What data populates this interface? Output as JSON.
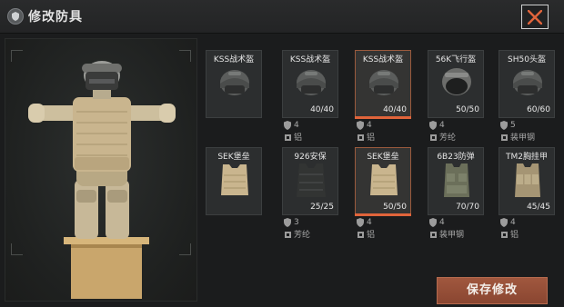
{
  "title": "修改防具",
  "save_label": "保存修改",
  "accent": "#e0643b",
  "items": [
    {
      "name": "KSS战术盔",
      "durability": "",
      "armor_class": "",
      "material": "",
      "selected": false,
      "kind": "helmet"
    },
    {
      "name": "KSS战术盔",
      "durability": "40/40",
      "armor_class": "4",
      "material": "铝",
      "selected": false,
      "kind": "helmet"
    },
    {
      "name": "KSS战术盔",
      "durability": "40/40",
      "armor_class": "4",
      "material": "铝",
      "selected": true,
      "kind": "helmet"
    },
    {
      "name": "56K飞行盔",
      "durability": "50/50",
      "armor_class": "4",
      "material": "芳纶",
      "selected": false,
      "kind": "helmet-visor"
    },
    {
      "name": "SH50头盔",
      "durability": "60/60",
      "armor_class": "5",
      "material": "装甲钢",
      "selected": false,
      "kind": "helmet"
    },
    {
      "name": "SEK堡垒",
      "durability": "",
      "armor_class": "",
      "material": "",
      "selected": false,
      "kind": "vest-tan"
    },
    {
      "name": "926安保",
      "durability": "25/25",
      "armor_class": "3",
      "material": "芳纶",
      "selected": false,
      "kind": "vest-black"
    },
    {
      "name": "SEK堡垒",
      "durability": "50/50",
      "armor_class": "4",
      "material": "铝",
      "selected": true,
      "kind": "vest-tan"
    },
    {
      "name": "6B23防弹",
      "durability": "70/70",
      "armor_class": "4",
      "material": "装甲钢",
      "selected": false,
      "kind": "vest-green"
    },
    {
      "name": "TM2胸挂甲",
      "durability": "45/45",
      "armor_class": "4",
      "material": "铝",
      "selected": false,
      "kind": "rig-tan"
    }
  ]
}
